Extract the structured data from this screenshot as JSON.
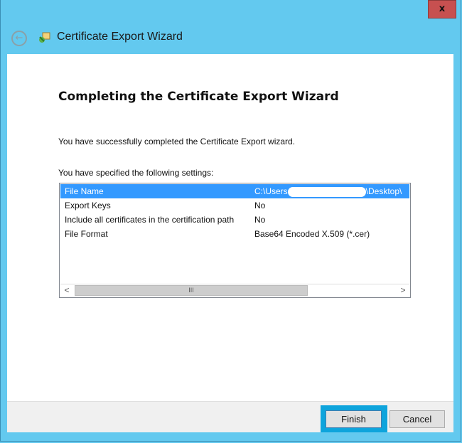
{
  "window": {
    "title": "Certificate Export Wizard",
    "close_label": "x"
  },
  "page": {
    "heading": "Completing the Certificate Export Wizard",
    "success_text": "You have successfully completed the Certificate Export wizard.",
    "settings_label": "You have specified the following settings:"
  },
  "settings": [
    {
      "name": "File Name",
      "value_prefix": "C:\\Users",
      "value_suffix": "\\Desktop\\"
    },
    {
      "name": "Export Keys",
      "value": "No"
    },
    {
      "name": "Include all certificates in the certification path",
      "value": "No"
    },
    {
      "name": "File Format",
      "value": "Base64 Encoded X.509 (*.cer)"
    }
  ],
  "scrollbar": {
    "left": "<",
    "right": ">",
    "grip": "III"
  },
  "buttons": {
    "finish": "Finish",
    "cancel": "Cancel"
  }
}
